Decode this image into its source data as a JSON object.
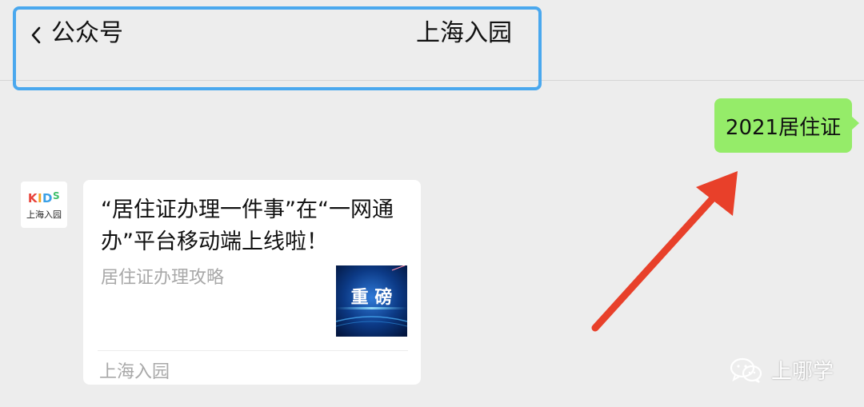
{
  "header": {
    "back_label": "公众号",
    "title": "上海入园"
  },
  "sent_message": {
    "text": "2021居住证"
  },
  "received": {
    "avatar": {
      "logo_text": "KIDS",
      "name": "上海入园"
    },
    "card": {
      "title": "“居住证办理一件事”在“一网通办”平台移动端上线啦！",
      "description": "居住证办理攻略",
      "thumbnail_text": "重 磅",
      "source": "上海入园"
    }
  },
  "watermark": {
    "text": "上哪学",
    "icon": "wechat-icon"
  },
  "colors": {
    "background": "#ededed",
    "sent_bubble": "#95ec69",
    "highlight_border": "#4aa8ee",
    "arrow": "#e8402a"
  }
}
